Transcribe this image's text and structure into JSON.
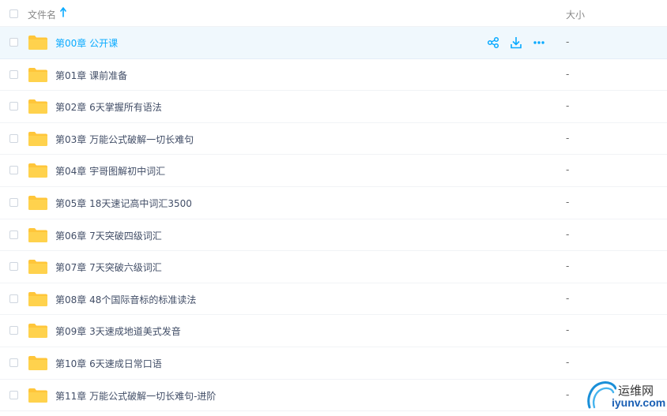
{
  "header": {
    "name_label": "文件名",
    "size_label": "大小",
    "sort_icon": "arrow-up-icon"
  },
  "colors": {
    "accent": "#09aaff",
    "folder": "#ffc63a",
    "active_row": "#f0f8fd"
  },
  "files": [
    {
      "name": "第00章 公开课",
      "size": "-",
      "hovered": true
    },
    {
      "name": "第01章 课前准备",
      "size": "-"
    },
    {
      "name": "第02章 6天掌握所有语法",
      "size": "-"
    },
    {
      "name": "第03章 万能公式破解一切长难句",
      "size": "-"
    },
    {
      "name": "第04章 宇哥图解初中词汇",
      "size": "-"
    },
    {
      "name": "第05章 18天速记高中词汇3500",
      "size": "-"
    },
    {
      "name": "第06章 7天突破四级词汇",
      "size": "-"
    },
    {
      "name": "第07章 7天突破六级词汇",
      "size": "-"
    },
    {
      "name": "第08章 48个国际音标的标准读法",
      "size": "-"
    },
    {
      "name": "第09章 3天速成地道美式发音",
      "size": "-"
    },
    {
      "name": "第10章 6天速成日常口语",
      "size": "-"
    },
    {
      "name": "第11章 万能公式破解一切长难句-进阶",
      "size": "-"
    }
  ],
  "row_actions": [
    "share-icon",
    "download-icon",
    "more-icon"
  ],
  "watermark": {
    "text_cn": "运维网",
    "text_en": "iyunv.com"
  }
}
